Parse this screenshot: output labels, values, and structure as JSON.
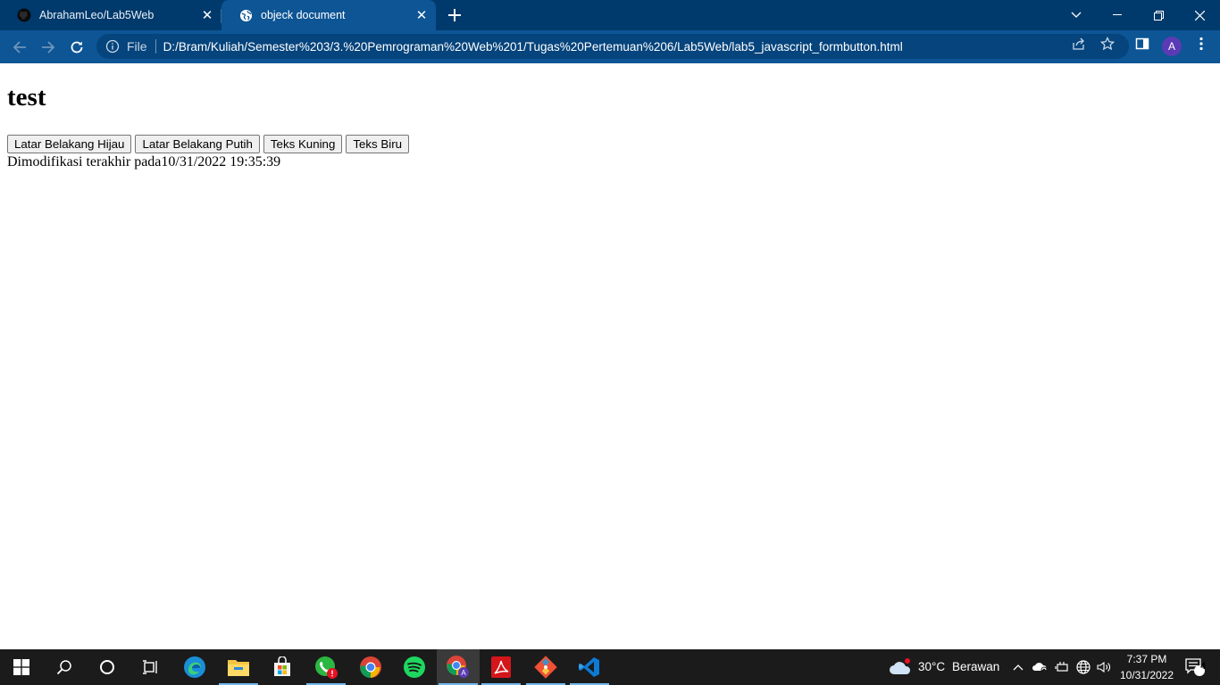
{
  "browser": {
    "tabs": [
      {
        "title": "AbrahamLeo/Lab5Web",
        "favicon": "github-icon",
        "active": false
      },
      {
        "title": "objeck document",
        "favicon": "globe-icon",
        "active": true
      }
    ],
    "address_scheme": "File",
    "address_url": "D:/Bram/Kuliah/Semester%203/3.%20Pemrograman%20Web%201/Tugas%20Pertemuan%206/Lab5Web/lab5_javascript_formbutton.html",
    "profile_initial": "A",
    "theme_color": "#003a6c"
  },
  "page": {
    "heading": "test",
    "buttons": [
      {
        "label": "Latar Belakang Hijau"
      },
      {
        "label": "Latar Belakang Putih"
      },
      {
        "label": "Teks Kuning"
      },
      {
        "label": "Teks Biru"
      }
    ],
    "modified_label": "Dimodifikasi terakhir pada",
    "modified_value": "10/31/2022 19:35:39"
  },
  "taskbar": {
    "apps": [
      "start-icon",
      "search-icon",
      "cortana-icon",
      "task-view-icon",
      "edge-icon",
      "file-explorer-icon",
      "store-icon",
      "whatsapp-icon",
      "chrome-icon",
      "chrome-profile-icon",
      "acrobat-icon",
      "git-icon",
      "vscode-icon"
    ],
    "weather_temp": "30°C",
    "weather_desc": "Berawan",
    "time": "7:37 PM",
    "date": "10/31/2022",
    "notification_count": "4"
  }
}
